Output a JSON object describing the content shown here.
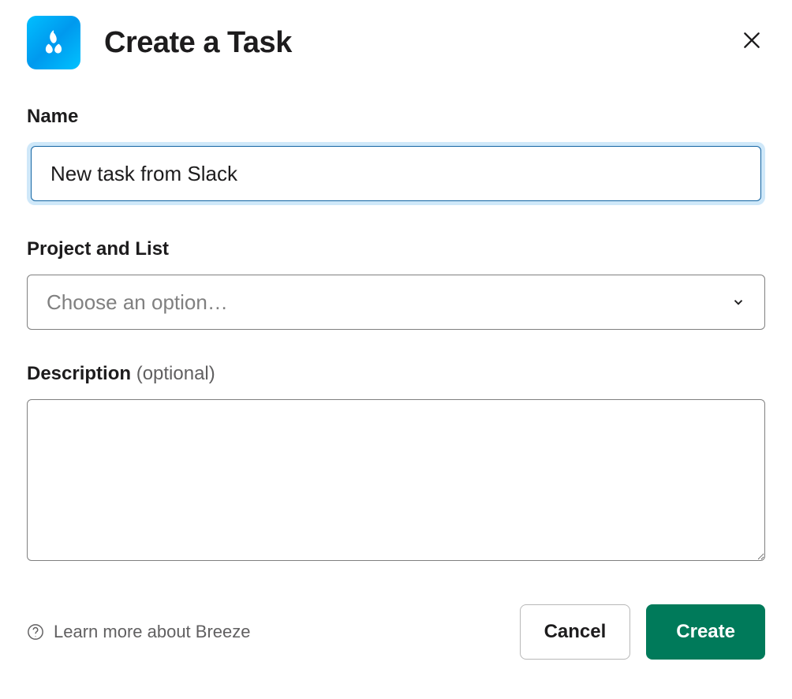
{
  "header": {
    "title": "Create a Task"
  },
  "fields": {
    "name": {
      "label": "Name",
      "value": "New task from Slack"
    },
    "project": {
      "label": "Project and List",
      "placeholder": "Choose an option…"
    },
    "description": {
      "label": "Description",
      "optional": "(optional)",
      "value": ""
    }
  },
  "footer": {
    "help_text": "Learn more about Breeze",
    "cancel_label": "Cancel",
    "create_label": "Create"
  }
}
